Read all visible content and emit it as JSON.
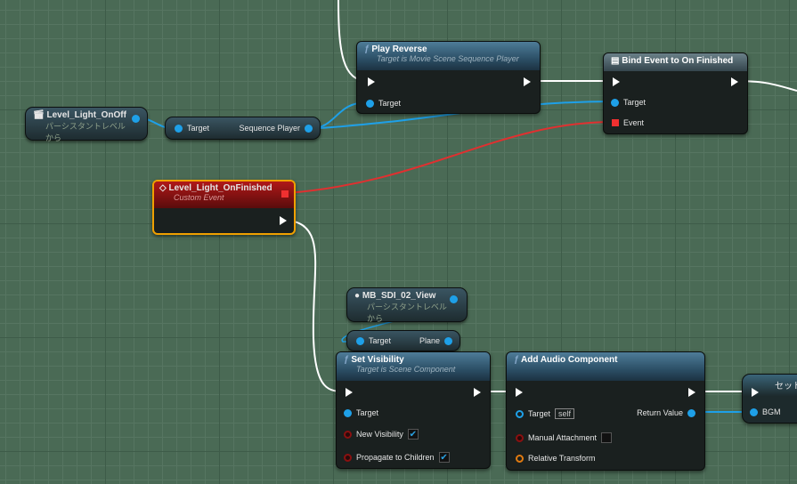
{
  "nodes": {
    "level_light_onoff": {
      "title": "Level_Light_OnOff",
      "subtitle": "パーシスタントレベル から"
    },
    "sequence_player_get": {
      "target": "Target",
      "output": "Sequence Player"
    },
    "play_reverse": {
      "title": "Play Reverse",
      "subtitle": "Target is Movie Scene Sequence Player",
      "target": "Target"
    },
    "bind_event": {
      "title": "Bind Event to On Finished",
      "target": "Target",
      "event": "Event"
    },
    "custom_event": {
      "title": "Level_Light_OnFinished",
      "subtitle": "Custom Event"
    },
    "mb_sdi_view": {
      "title": "MB_SDI_02_View",
      "subtitle": "パーシスタントレベル から"
    },
    "plane_get": {
      "target": "Target",
      "output": "Plane"
    },
    "set_visibility": {
      "title": "Set Visibility",
      "subtitle": "Target is Scene Component",
      "target": "Target",
      "new_visibility": "New Visibility",
      "new_visibility_checked": true,
      "propagate": "Propagate to Children",
      "propagate_checked": true
    },
    "add_audio": {
      "title": "Add Audio Component",
      "target": "Target",
      "target_value": "self",
      "manual_attachment": "Manual Attachment",
      "manual_attachment_checked": false,
      "relative_transform": "Relative Transform",
      "return_value": "Return Value"
    },
    "set_bgm": {
      "title": "セット",
      "input": "BGM"
    }
  },
  "colors": {
    "exec": "#ffffff",
    "object": "#1ea0e8",
    "delegate": "#f03030",
    "bool": "#8a1010",
    "transform": "#e07a10",
    "selected": "#f0a000"
  }
}
